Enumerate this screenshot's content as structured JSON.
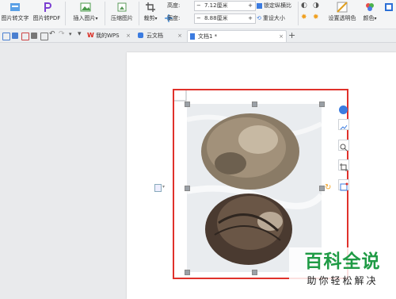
{
  "ribbon": {
    "buttons": {
      "pic_to_text": "图片转文字",
      "pic_to_pdf": "图片转PDF",
      "insert_picture": "插入图片",
      "compress_picture": "压缩图片",
      "crop": "裁剪",
      "set_transparent": "设置透明色",
      "color": "颜色"
    },
    "size": {
      "height_label": "高度:",
      "height_value": "7.12厘米",
      "width_label": "宽度:",
      "width_value": "8.88厘米",
      "lock_ratio": "锁定纵横比",
      "reset_size": "重设大小",
      "minus": "−",
      "plus": "+"
    }
  },
  "tabs": {
    "items": [
      {
        "label": "我的WPS",
        "active": false
      },
      {
        "label": "云文档",
        "active": false
      },
      {
        "label": "文档1 *",
        "active": true
      }
    ],
    "new_tab": "+",
    "close": "×"
  },
  "watermark": {
    "title": "百科全说",
    "subtitle": "助你轻松解决"
  },
  "colors": {
    "selection": "#e0312b",
    "brand_green": "#1f9b45",
    "wps_red": "#d9261c"
  }
}
